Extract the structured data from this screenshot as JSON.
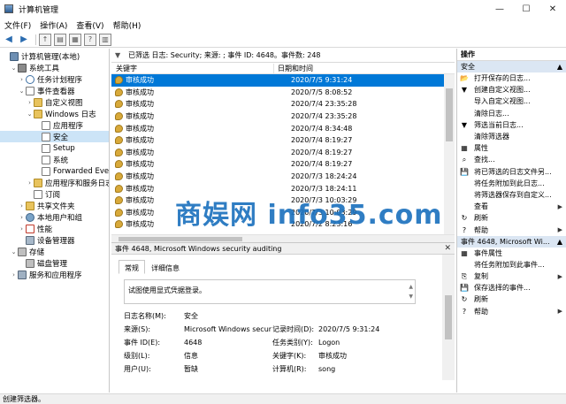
{
  "window": {
    "title": "计算机管理",
    "min": "—",
    "max": "☐",
    "close": "✕"
  },
  "menu": [
    "文件(F)",
    "操作(A)",
    "查看(V)",
    "帮助(H)"
  ],
  "tree": [
    {
      "label": "计算机管理(本地)",
      "depth": 0,
      "exp": "",
      "icon": "ic-comp"
    },
    {
      "label": "系统工具",
      "depth": 1,
      "exp": "⌄",
      "icon": "ic-tool"
    },
    {
      "label": "任务计划程序",
      "depth": 2,
      "exp": "›",
      "icon": "ic-clock"
    },
    {
      "label": "事件查看器",
      "depth": 2,
      "exp": "⌄",
      "icon": "ic-log"
    },
    {
      "label": "自定义视图",
      "depth": 3,
      "exp": "›",
      "icon": "ic-folder"
    },
    {
      "label": "Windows 日志",
      "depth": 3,
      "exp": "⌄",
      "icon": "ic-folder"
    },
    {
      "label": "应用程序",
      "depth": 4,
      "exp": "",
      "icon": "ic-log"
    },
    {
      "label": "安全",
      "depth": 4,
      "exp": "",
      "icon": "ic-log",
      "selected": true
    },
    {
      "label": "Setup",
      "depth": 4,
      "exp": "",
      "icon": "ic-log"
    },
    {
      "label": "系统",
      "depth": 4,
      "exp": "",
      "icon": "ic-log"
    },
    {
      "label": "Forwarded Eve",
      "depth": 4,
      "exp": "",
      "icon": "ic-log"
    },
    {
      "label": "应用程序和服务日志",
      "depth": 3,
      "exp": "›",
      "icon": "ic-folder"
    },
    {
      "label": "订阅",
      "depth": 3,
      "exp": "",
      "icon": "ic-log"
    },
    {
      "label": "共享文件夹",
      "depth": 2,
      "exp": "›",
      "icon": "ic-folder"
    },
    {
      "label": "本地用户和组",
      "depth": 2,
      "exp": "›",
      "icon": "ic-user"
    },
    {
      "label": "性能",
      "depth": 2,
      "exp": "›",
      "icon": "ic-perf"
    },
    {
      "label": "设备管理器",
      "depth": 2,
      "exp": "",
      "icon": "ic-dev"
    },
    {
      "label": "存储",
      "depth": 1,
      "exp": "⌄",
      "icon": "ic-disk"
    },
    {
      "label": "磁盘管理",
      "depth": 2,
      "exp": "",
      "icon": "ic-disk"
    },
    {
      "label": "服务和应用程序",
      "depth": 1,
      "exp": "›",
      "icon": "ic-svc"
    }
  ],
  "filter": {
    "text": "已筛选 日志: Security; 来源: ; 事件 ID: 4648。事件数: 248"
  },
  "columns": {
    "keyword": "关键字",
    "datetime": "日期和时间"
  },
  "events": [
    {
      "keyword": "审核成功",
      "datetime": "2020/7/5 9:31:24",
      "selected": true
    },
    {
      "keyword": "审核成功",
      "datetime": "2020/7/5 8:08:52"
    },
    {
      "keyword": "审核成功",
      "datetime": "2020/7/4 23:35:28"
    },
    {
      "keyword": "审核成功",
      "datetime": "2020/7/4 23:35:28"
    },
    {
      "keyword": "审核成功",
      "datetime": "2020/7/4 8:34:48"
    },
    {
      "keyword": "审核成功",
      "datetime": "2020/7/4 8:19:27"
    },
    {
      "keyword": "审核成功",
      "datetime": "2020/7/4 8:19:27"
    },
    {
      "keyword": "审核成功",
      "datetime": "2020/7/4 8:19:27"
    },
    {
      "keyword": "审核成功",
      "datetime": "2020/7/3 18:24:24"
    },
    {
      "keyword": "审核成功",
      "datetime": "2020/7/3 18:24:11"
    },
    {
      "keyword": "审核成功",
      "datetime": "2020/7/3 10:03:29"
    },
    {
      "keyword": "审核成功",
      "datetime": "2020/7/3 10:03:29"
    },
    {
      "keyword": "审核成功",
      "datetime": "2020/7/2 8:23:16"
    }
  ],
  "detail": {
    "header": "事件 4648, Microsoft Windows security auditing",
    "close": "✕",
    "tabs": [
      "常规",
      "详细信息"
    ],
    "description": "试图使用显式凭据登录。",
    "props": [
      {
        "l1": "日志名称(M):",
        "v1": "安全",
        "l2": "",
        "v2": ""
      },
      {
        "l1": "来源(S):",
        "v1": "Microsoft Windows secur",
        "l2": "记录时间(D):",
        "v2": "2020/7/5 9:31:24"
      },
      {
        "l1": "事件 ID(E):",
        "v1": "4648",
        "l2": "任务类别(Y):",
        "v2": "Logon"
      },
      {
        "l1": "级别(L):",
        "v1": "信息",
        "l2": "关键字(K):",
        "v2": "审核成功"
      },
      {
        "l1": "用户(U):",
        "v1": "暂缺",
        "l2": "计算机(R):",
        "v2": "song"
      }
    ]
  },
  "actions": {
    "header": "操作",
    "section1": "安全",
    "items1": [
      {
        "label": "打开保存的日志...",
        "icon": "📂",
        "arrow": ""
      },
      {
        "label": "创建自定义视图...",
        "icon": "▼",
        "arrow": ""
      },
      {
        "label": "导入自定义视图...",
        "icon": "",
        "arrow": ""
      },
      {
        "label": "清除日志...",
        "icon": "",
        "arrow": ""
      },
      {
        "label": "筛选当前日志...",
        "icon": "▼",
        "arrow": ""
      },
      {
        "label": "清除筛选器",
        "icon": "",
        "arrow": ""
      },
      {
        "label": "属性",
        "icon": "▦",
        "arrow": ""
      },
      {
        "label": "查找...",
        "icon": "⌕",
        "arrow": ""
      },
      {
        "label": "将已筛选的日志文件另...",
        "icon": "💾",
        "arrow": ""
      },
      {
        "label": "将任务附加到此日志...",
        "icon": "",
        "arrow": ""
      },
      {
        "label": "将筛选器保存到自定义...",
        "icon": "",
        "arrow": ""
      },
      {
        "label": "查看",
        "icon": "",
        "arrow": "▶"
      },
      {
        "label": "刷新",
        "icon": "↻",
        "arrow": ""
      },
      {
        "label": "帮助",
        "icon": "?",
        "arrow": "▶"
      }
    ],
    "section2": "事件 4648, Microsoft Wi...",
    "items2": [
      {
        "label": "事件属性",
        "icon": "▦",
        "arrow": ""
      },
      {
        "label": "将任务附加到此事件...",
        "icon": "",
        "arrow": ""
      },
      {
        "label": "复制",
        "icon": "⎘",
        "arrow": "▶"
      },
      {
        "label": "保存选择的事件...",
        "icon": "💾",
        "arrow": ""
      },
      {
        "label": "刷新",
        "icon": "↻",
        "arrow": ""
      },
      {
        "label": "帮助",
        "icon": "?",
        "arrow": "▶"
      }
    ]
  },
  "status": "创建筛选器。",
  "watermark": "商娱网 info35.com"
}
